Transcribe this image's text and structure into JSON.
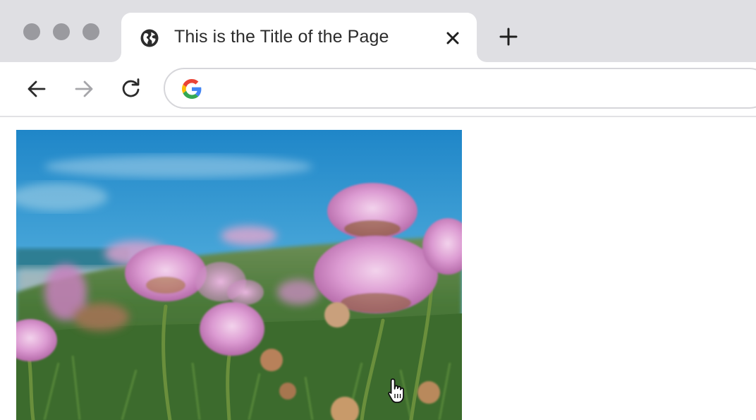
{
  "browser": {
    "window_controls": [
      "close",
      "minimize",
      "maximize"
    ],
    "tab": {
      "title": "This is the Title of the Page",
      "favicon": "globe-icon",
      "close_icon": "close-icon"
    },
    "new_tab_icon": "plus-icon",
    "toolbar": {
      "back_icon": "arrow-left-icon",
      "forward_icon": "arrow-right-icon",
      "reload_icon": "reload-icon",
      "address_bar": {
        "provider_icon": "google-icon",
        "value": "",
        "placeholder": ""
      }
    }
  },
  "page": {
    "image": {
      "subject": "pink-thrift-flowers-photo"
    },
    "cursor_icon": "hand-pointer-icon"
  },
  "colors": {
    "tabstrip_bg": "#dfdfe3",
    "traffic_light": "#9a9a9f",
    "google_blue": "#4285F4",
    "google_red": "#EA4335",
    "google_yellow": "#FBBC05",
    "google_green": "#34A853"
  }
}
